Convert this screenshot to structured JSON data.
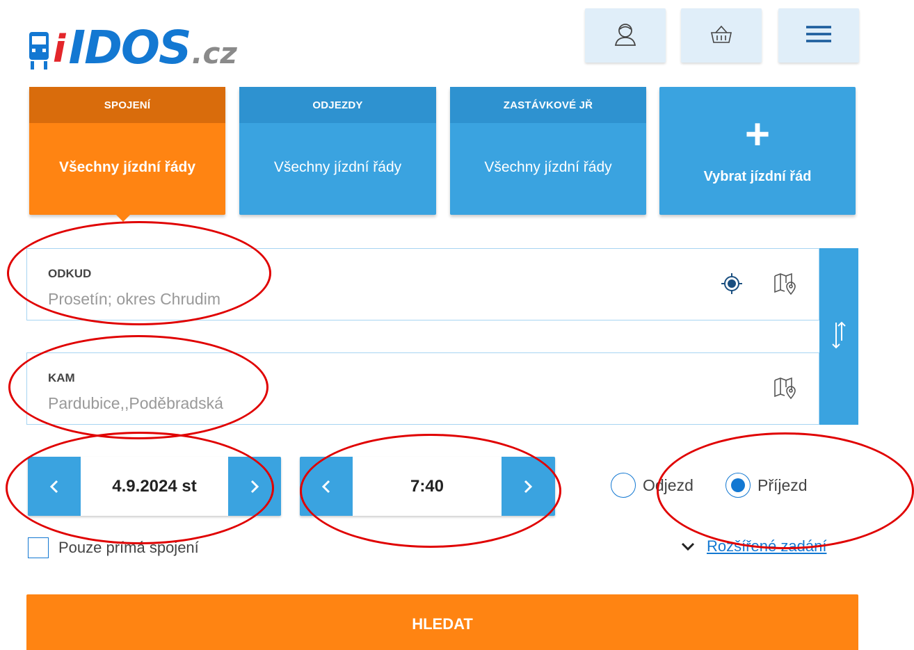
{
  "header": {
    "logo_i": "i",
    "logo_main": "IDOS",
    "logo_suffix": ".cz"
  },
  "tabs": [
    {
      "title": "SPOJENÍ",
      "subtitle": "Všechny jízdní řády",
      "active": true
    },
    {
      "title": "ODJEZDY",
      "subtitle": "Všechny jízdní řády",
      "active": false
    },
    {
      "title": "ZASTÁVKOVÉ JŘ",
      "subtitle": "Všechny jízdní řády",
      "active": false
    }
  ],
  "add_timetable": {
    "plus": "+",
    "label": "Vybrat jízdní řád"
  },
  "from": {
    "label": "ODKUD",
    "placeholder": "Prosetín; okres Chrudim"
  },
  "to": {
    "label": "KAM",
    "placeholder": "Pardubice,,Poděbradská"
  },
  "date": {
    "value": "4.9.2024 st"
  },
  "time": {
    "value": "7:40"
  },
  "mode": {
    "departure_label": "Odjezd",
    "arrival_label": "Příjezd",
    "selected": "arrival"
  },
  "direct_only": {
    "label": "Pouze přímá spojení",
    "checked": false
  },
  "advanced": {
    "label": "Rozšířené zadání"
  },
  "search": {
    "label": "HLEDAT"
  },
  "colors": {
    "orange": "#ff8412",
    "blue": "#3aa3e0",
    "link_blue": "#1378d2",
    "annotation_red": "#e00000"
  }
}
